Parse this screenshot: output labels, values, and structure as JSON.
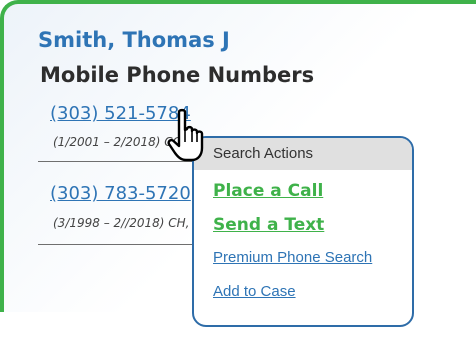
{
  "contact": {
    "name": "Smith, Thomas J"
  },
  "section": {
    "title": "Mobile Phone Numbers"
  },
  "phones": [
    {
      "number": "(303) 521-5784",
      "meta": "(1/2001 – 2/2018) CO"
    },
    {
      "number": "(303) 783-5720",
      "meta": "(3/1998 – 2//2018) CH, CO"
    }
  ],
  "popup": {
    "title": "Search Actions",
    "actions": [
      "Place a Call",
      "Send a Text",
      "Premium Phone Search",
      "Add to Case"
    ]
  },
  "colors": {
    "accent_green": "#3fb24a",
    "link_blue": "#2e74b5",
    "popup_border": "#2e6ca8"
  },
  "icons": {
    "cursor": "pointing-hand-icon"
  }
}
